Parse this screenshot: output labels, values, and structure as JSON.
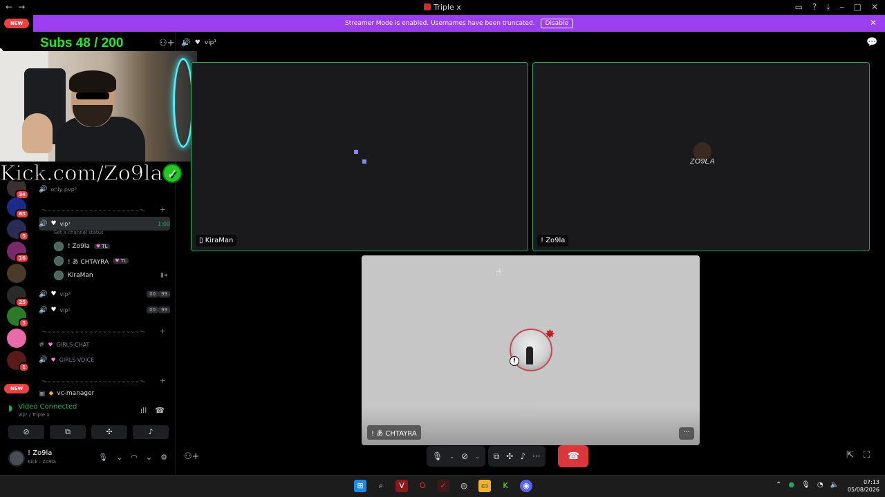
{
  "window": {
    "title": "Triple x",
    "nav_back": "←",
    "nav_fwd": "→"
  },
  "banner": {
    "text": "Streamer Mode is enabled. Usernames have been truncated.",
    "button": "Disable"
  },
  "overlay": {
    "subs": "Subs 48 / 200",
    "kick": "Kick.com/Zo9la"
  },
  "server_rail": {
    "new_top": "NEW",
    "new_bottom": "NEW",
    "badges": [
      "34",
      "63",
      "5",
      "16",
      "25",
      "3",
      "1"
    ]
  },
  "sidebar": {
    "channel_only_pvp": "only pvp³",
    "channel_vip1": "vip¹",
    "timer": "1:00",
    "set_status": "Set a channel status",
    "members": [
      {
        "name": "! Zo9la",
        "tag": "TL"
      },
      {
        "name": "! あ CHTAYRA",
        "tag": "TL"
      },
      {
        "name": "KiraMan",
        "tag": ""
      }
    ],
    "channel_vip3": "vip³",
    "channel_vip2": "vip²",
    "count_a": "00",
    "count_b": "99",
    "channel_girls_chat": "GIRLS-CHAT",
    "channel_girls_voice": "GIRLS-VOICE",
    "channel_vc_manager": "vc-manager",
    "divider": "ᯓ⌄⌄⌄⌄⌄⌄⌄⌄⌄⌄⌄⌄⌄⌄⌄⌄⌄⌄⌄⌄ᯓ"
  },
  "voice": {
    "status": "Video Connected",
    "location": "vip¹ / Triple x"
  },
  "user": {
    "name": "! Zo9la",
    "status": "Kick : Zo9la"
  },
  "stage": {
    "header_channel": "vip¹",
    "tiles": [
      {
        "label": "KiraMan"
      },
      {
        "label": "! Zo9la",
        "logo_text": "ZO9LA"
      }
    ],
    "big_tile": {
      "label": "! あ CHTAYRA"
    }
  },
  "taskbar": {
    "time": "07:13",
    "date": "05/08/2026"
  },
  "colors": {
    "accent": "#9b3ff0",
    "speaking": "#23a55a",
    "hangup": "#da373c",
    "subs": "#23e823"
  }
}
